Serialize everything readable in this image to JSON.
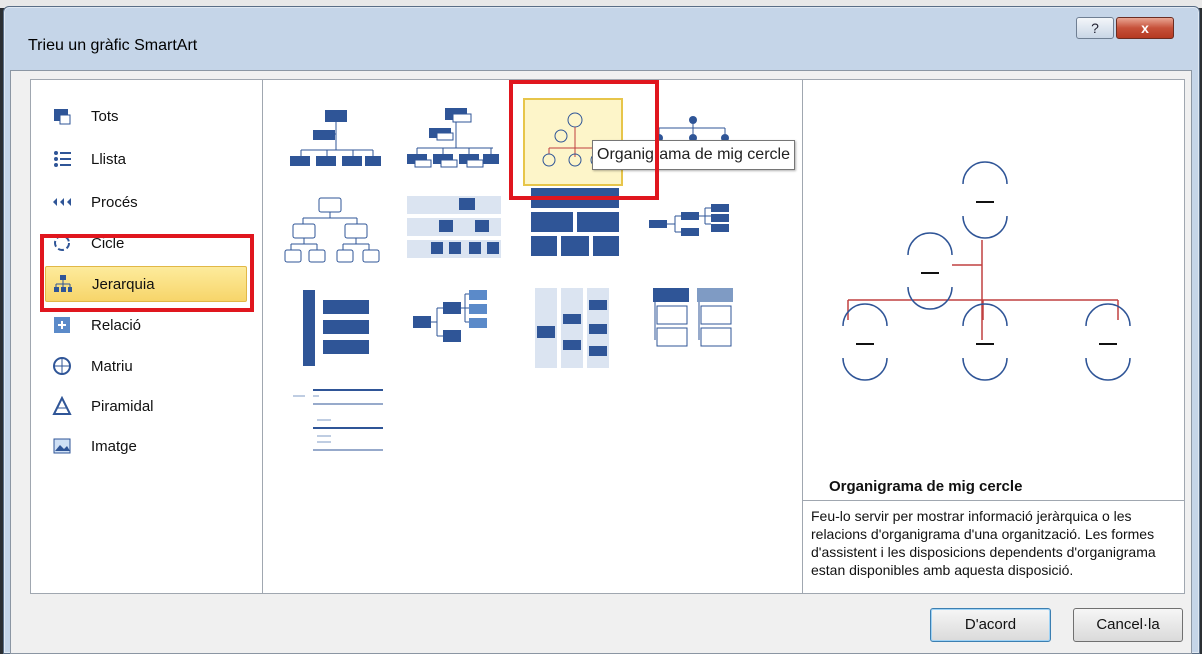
{
  "window": {
    "title": "Trieu un gràfic SmartArt",
    "help_label": "?",
    "close_label": "x"
  },
  "categories": [
    {
      "label": "Tots",
      "icon": "all-icon"
    },
    {
      "label": "Llista",
      "icon": "list-icon"
    },
    {
      "label": "Procés",
      "icon": "process-icon"
    },
    {
      "label": "Cicle",
      "icon": "cycle-icon"
    },
    {
      "label": "Jerarquia",
      "icon": "hierarchy-icon",
      "selected": true
    },
    {
      "label": "Relació",
      "icon": "relation-icon"
    },
    {
      "label": "Matriu",
      "icon": "matrix-icon"
    },
    {
      "label": "Piramidal",
      "icon": "pyramid-icon"
    },
    {
      "label": "Imatge",
      "icon": "picture-icon"
    }
  ],
  "tooltip": "Organigrama de mig cercle",
  "preview": {
    "title": "Organigrama de mig cercle",
    "description": "Feu-lo servir per mostrar informació jeràrquica o les relacions d'organigrama d'una organització. Les formes d'assistent i les disposicions dependents d'organigrama estan disponibles amb aquesta disposició."
  },
  "buttons": {
    "ok": "D'acord",
    "cancel": "Cancel·la"
  },
  "colors": {
    "accent": "#2f5597",
    "highlight": "#e0161e",
    "selection": "#f7d56a"
  }
}
